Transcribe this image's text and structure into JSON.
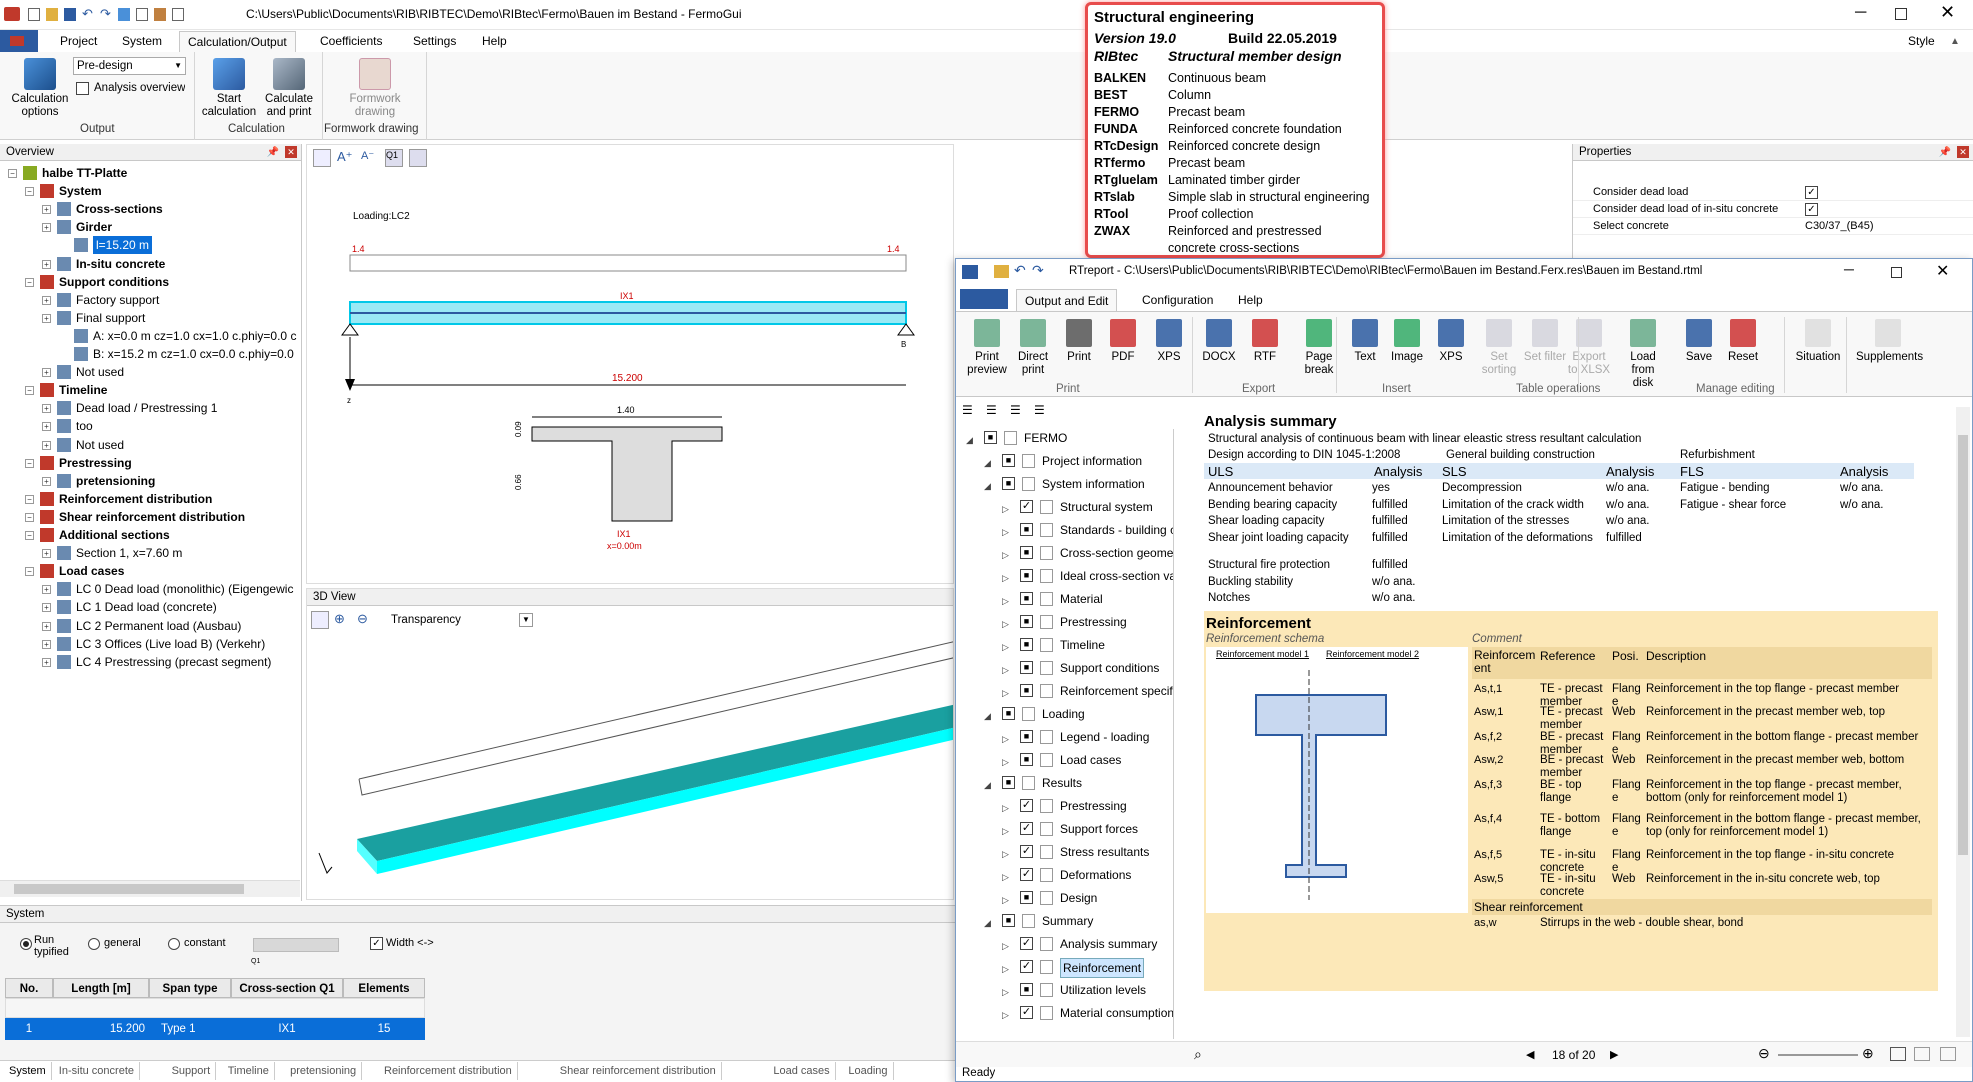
{
  "window": {
    "title": "C:\\Users\\Public\\Documents\\RIB\\RIBTEC\\Demo\\RIBtec\\Fermo\\Bauen im Bestand - FermoGui",
    "style_label": "Style"
  },
  "ribbon": {
    "tabs": [
      "Project",
      "System",
      "Calculation/Output",
      "Coefficients",
      "Settings",
      "Help"
    ],
    "active_tab": "Calculation/Output",
    "predesign_value": "Pre-design",
    "analysis_overview": "Analysis overview",
    "calc_options": "Calculation options",
    "start_calc": "Start calculation",
    "calc_print": "Calculate and print",
    "formwork": "Formwork drawing",
    "groups": [
      "Output",
      "Calculation",
      "Formwork drawing"
    ]
  },
  "overview": {
    "title": "Overview",
    "items": [
      {
        "label": "halbe TT-Platte",
        "lvl": 0,
        "bold": true
      },
      {
        "label": "System",
        "lvl": 1,
        "bold": true
      },
      {
        "label": "Cross-sections",
        "lvl": 2,
        "bold": true
      },
      {
        "label": "Girder",
        "lvl": 2,
        "bold": true
      },
      {
        "label": "l=15.20 m",
        "lvl": 3,
        "sel": true
      },
      {
        "label": "In-situ concrete",
        "lvl": 2,
        "bold": true
      },
      {
        "label": "Support conditions",
        "lvl": 1,
        "bold": true
      },
      {
        "label": "Factory support",
        "lvl": 2
      },
      {
        "label": "Final support",
        "lvl": 2
      },
      {
        "label": "A: x=0.0 m  cz=1.0 cx=1.0 c.phiy=0.0 c",
        "lvl": 3
      },
      {
        "label": "B: x=15.2 m  cz=1.0 cx=0.0 c.phiy=0.0",
        "lvl": 3
      },
      {
        "label": "Not used",
        "lvl": 2
      },
      {
        "label": "Timeline",
        "lvl": 1,
        "bold": true
      },
      {
        "label": "Dead load / Prestressing 1",
        "lvl": 2
      },
      {
        "label": "too",
        "lvl": 2
      },
      {
        "label": "Not used",
        "lvl": 2
      },
      {
        "label": "Prestressing",
        "lvl": 1,
        "bold": true
      },
      {
        "label": "pretensioning",
        "lvl": 2,
        "bold": true
      },
      {
        "label": "Reinforcement distribution",
        "lvl": 1,
        "bold": true
      },
      {
        "label": "Shear reinforcement distribution",
        "lvl": 1,
        "bold": true
      },
      {
        "label": "Additional sections",
        "lvl": 1,
        "bold": true
      },
      {
        "label": "Section 1, x=7.60 m",
        "lvl": 2
      },
      {
        "label": "Load cases",
        "lvl": 1,
        "bold": true
      },
      {
        "label": "LC 0 Dead load (monolithic) (Eigengewic",
        "lvl": 2
      },
      {
        "label": "LC 1 Dead load (concrete)",
        "lvl": 2
      },
      {
        "label": "LC 2 Permanent load (Ausbau)",
        "lvl": 2
      },
      {
        "label": "LC 3 Offices (Live load B) (Verkehr)",
        "lvl": 2
      },
      {
        "label": "LC 4 Prestressing (precast segment)",
        "lvl": 2
      }
    ]
  },
  "drawing": {
    "loading": "Loading:LC2",
    "left_val": "1.4",
    "right_val": "1.4",
    "ix1": "IX1",
    "span": "15.200",
    "b": "B",
    "z": "z",
    "cs_width": "1.40",
    "cs_h1": "0.09",
    "cs_h2": "0.66",
    "cs_label": "IX1",
    "cs_x": "x=0.00m"
  },
  "view3d": {
    "title": "3D View",
    "transparency": "Transparency"
  },
  "properties": {
    "title": "Properties",
    "rows": [
      {
        "label": "Consider dead load",
        "value": "✓"
      },
      {
        "label": "Consider dead load of in-situ concrete",
        "value": "✓"
      },
      {
        "label": "Select concrete",
        "value": "C30/37_(B45)"
      }
    ]
  },
  "splash": {
    "title": "Structural engineering",
    "version": "Version 19.0",
    "build": "Build    22.05.2019",
    "brand": "RIBtec",
    "brand_desc": "Structural member design",
    "items": [
      {
        "k": "BALKEN",
        "v": "Continuous beam"
      },
      {
        "k": "BEST",
        "v": "Column"
      },
      {
        "k": "FERMO",
        "v": "Precast beam"
      },
      {
        "k": "FUNDA",
        "v": "Reinforced concrete foundation"
      },
      {
        "k": "RTcDesign",
        "v": "Reinforced concrete design"
      },
      {
        "k": "RTfermo",
        "v": "Precast beam"
      },
      {
        "k": "RTgluelam",
        "v": "Laminated timber girder"
      },
      {
        "k": "RTslab",
        "v": "Simple slab in structural engineering"
      },
      {
        "k": "RTool",
        "v": "Proof collection"
      },
      {
        "k": "ZWAX",
        "v": "Reinforced and prestressed"
      },
      {
        "k": "",
        "v": "concrete cross-sections"
      }
    ]
  },
  "system": {
    "title": "System",
    "run_typified": "Run typified",
    "general": "general",
    "constant": "constant",
    "q1": "Q1",
    "width": "Width <->",
    "headers": [
      "No.",
      "Length [m]",
      "Span type",
      "Cross-section Q1",
      "Elements"
    ],
    "row": [
      "1",
      "15.200",
      "Type 1",
      "IX1",
      "15"
    ],
    "tabs": [
      "System",
      "In-situ concrete",
      "Support",
      "Timeline",
      "pretensioning",
      "Reinforcement distribution",
      "Shear reinforcement distribution",
      "Load cases",
      "Loading"
    ],
    "status": "Ready"
  },
  "report": {
    "title": "RTreport - C:\\Users\\Public\\Documents\\RIB\\RIBTEC\\Demo\\RIBtec\\Fermo\\Bauen im Bestand.Ferx.res\\Bauen im Bestand.rtml",
    "tabs": [
      "Output and Edit",
      "Configuration",
      "Help"
    ],
    "buttons": [
      "Print preview",
      "Direct print",
      "Print",
      "PDF",
      "XPS",
      "DOCX",
      "RTF",
      "Page break",
      "Text",
      "Image",
      "XPS",
      "Set sorting",
      "Set filter",
      "Export to XLSX",
      "Load from disk",
      "Save",
      "Reset",
      "Situation",
      "Supplements"
    ],
    "groups": [
      "Print",
      "Export",
      "Insert",
      "Table operations",
      "Manage editing"
    ],
    "tree": [
      {
        "label": "FERMO",
        "lvl": 0
      },
      {
        "label": "Project information",
        "lvl": 1
      },
      {
        "label": "System information",
        "lvl": 1
      },
      {
        "label": "Structural system",
        "lvl": 2,
        "chk": true
      },
      {
        "label": "Standards - building c",
        "lvl": 2
      },
      {
        "label": "Cross-section geomet",
        "lvl": 2
      },
      {
        "label": "Ideal cross-section va",
        "lvl": 2
      },
      {
        "label": "Material",
        "lvl": 2
      },
      {
        "label": "Prestressing",
        "lvl": 2
      },
      {
        "label": "Timeline",
        "lvl": 2
      },
      {
        "label": "Support conditions",
        "lvl": 2
      },
      {
        "label": "Reinforcement specifi",
        "lvl": 2
      },
      {
        "label": "Loading",
        "lvl": 1
      },
      {
        "label": "Legend - loading",
        "lvl": 2
      },
      {
        "label": "Load cases",
        "lvl": 2
      },
      {
        "label": "Results",
        "lvl": 1
      },
      {
        "label": "Prestressing",
        "lvl": 2,
        "chk": true
      },
      {
        "label": "Support forces",
        "lvl": 2,
        "chk": true
      },
      {
        "label": "Stress resultants",
        "lvl": 2,
        "chk": true
      },
      {
        "label": "Deformations",
        "lvl": 2,
        "chk": true
      },
      {
        "label": "Design",
        "lvl": 2
      },
      {
        "label": "Summary",
        "lvl": 1
      },
      {
        "label": "Analysis summary",
        "lvl": 2,
        "chk": true
      },
      {
        "label": "Reinforcement",
        "lvl": 2,
        "chk": true,
        "sel": true
      },
      {
        "label": "Utilization levels",
        "lvl": 2
      },
      {
        "label": "Material consumption",
        "lvl": 2,
        "chk": true
      }
    ],
    "analysis_title": "Analysis summary",
    "analysis_l1": "Structural analysis of continuous beam  with linear eleastic stress resultant calculation",
    "analysis_l2": "Design according to DIN 1045-1:2008",
    "gen_bc": "General building construction",
    "refurb": "Refurbishment",
    "uls": "ULS",
    "sls": "SLS",
    "fls": "FLS",
    "analysis": "Analysis",
    "uls_rows": [
      [
        "Announcement behavior",
        "yes"
      ],
      [
        "Bending bearing capacity",
        "fulfilled"
      ],
      [
        "Shear loading capacity",
        "fulfilled"
      ],
      [
        "Shear joint loading capacity",
        "fulfilled"
      ]
    ],
    "sls_rows": [
      [
        "Decompression",
        "w/o ana."
      ],
      [
        "Limitation of the crack width",
        "w/o ana."
      ],
      [
        "Limitation of the stresses",
        "w/o ana."
      ],
      [
        "Limitation of the deformations",
        "fulfilled"
      ]
    ],
    "fls_rows": [
      [
        "Fatigue - bending",
        "w/o ana."
      ],
      [
        "Fatigue - shear force",
        "w/o ana."
      ]
    ],
    "other_rows": [
      [
        "Structural fire protection",
        "fulfilled"
      ],
      [
        "Buckling stability",
        "w/o ana."
      ],
      [
        "Notches",
        "w/o ana."
      ]
    ],
    "reinf_title": "Reinforcement",
    "reinf_schema": "Reinforcement schema",
    "comment": "Comment",
    "model1": "Reinforcement model 1",
    "model2": "Reinforcement model 2",
    "reinf_headers": [
      "Reinforcem ent",
      "Reference",
      "Posi.",
      "Description"
    ],
    "reinf_rows": [
      [
        "As,t,1",
        "TE - precast member",
        "Flang e",
        "Reinforcement in the top flange - precast member"
      ],
      [
        "Asw,1",
        "TE - precast member",
        "Web",
        "Reinforcement in the precast member web, top"
      ],
      [
        "As,f,2",
        "BE - precast member",
        "Flang e",
        "Reinforcement in the bottom flange - precast member"
      ],
      [
        "Asw,2",
        "BE - precast member",
        "Web",
        "Reinforcement in the precast member web, bottom"
      ],
      [
        "As,f,3",
        "BE - top flange",
        "Flang e",
        "Reinforcement in the top flange - precast member, bottom (only for reinforcement model 1)"
      ],
      [
        "As,f,4",
        "TE - bottom flange",
        "Flang e",
        "Reinforcement in the bottom flange - precast member, top (only for reinforcement model 1)"
      ],
      [
        "As,f,5",
        "TE - in-situ concrete",
        "Flang e",
        "Reinforcement in the top flange - in-situ concrete"
      ],
      [
        "Asw,5",
        "TE - in-situ concrete",
        "Web",
        "Reinforcement in the in-situ concrete web, top"
      ]
    ],
    "shear_title": "Shear reinforcement",
    "shear_row": [
      "as,w",
      "Stirrups in the web - double shear, bond"
    ],
    "page": "18 of 20",
    "status": "Ready"
  }
}
